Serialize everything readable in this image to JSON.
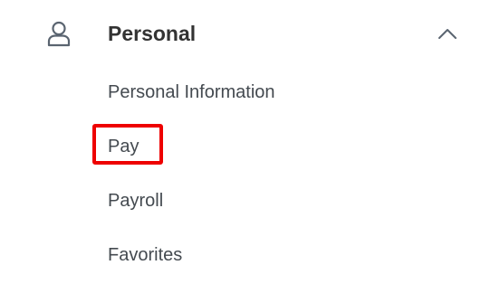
{
  "section": {
    "title": "Personal",
    "icon": "person-icon",
    "toggle_icon": "chevron-up-icon",
    "expanded": true
  },
  "menu": {
    "items": [
      {
        "label": "Personal Information"
      },
      {
        "label": "Pay",
        "highlighted": true
      },
      {
        "label": "Payroll"
      },
      {
        "label": "Favorites"
      }
    ]
  },
  "colors": {
    "title": "#333333",
    "item_text": "#444a50",
    "icon": "#5a6470",
    "highlight": "#ee0000"
  }
}
